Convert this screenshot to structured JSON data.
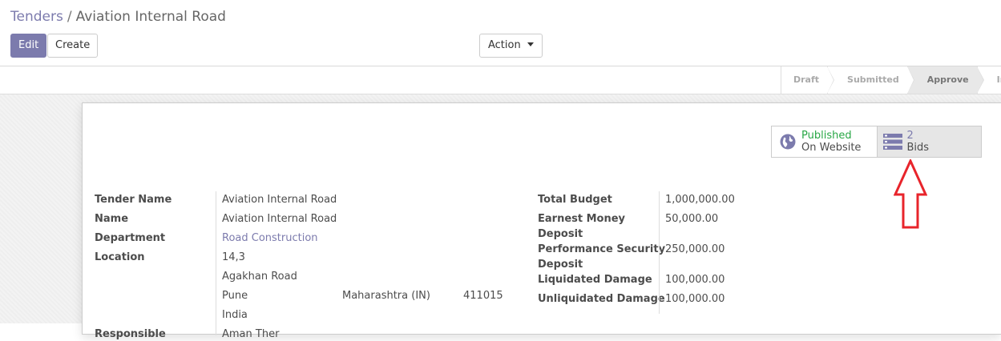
{
  "breadcrumb": {
    "parent": "Tenders",
    "separator": "/",
    "current": "Aviation Internal Road"
  },
  "buttons": {
    "edit": "Edit",
    "create": "Create",
    "action": "Action"
  },
  "statusbar": {
    "stages": [
      {
        "label": "Draft",
        "active": false
      },
      {
        "label": "Submitted",
        "active": false
      },
      {
        "label": "Approve",
        "active": true
      },
      {
        "label": "In Progress",
        "active": false
      }
    ]
  },
  "smart_buttons": {
    "website": {
      "status": "Published",
      "label": "On Website",
      "icon": "globe-icon"
    },
    "bids": {
      "count": "2",
      "label": "Bids",
      "icon": "bids-stack-icon"
    }
  },
  "colors": {
    "brand": "#7c7bad",
    "published": "#28a745",
    "annotation_arrow": "#e8242b"
  },
  "form": {
    "left": {
      "tender_name_label": "Tender Name",
      "tender_name": "Aviation Internal Road",
      "name_label": "Name",
      "name": "Aviation Internal Road",
      "department_label": "Department",
      "department": "Road Construction",
      "location_label": "Location",
      "street": "14,3",
      "street2": "Agakhan Road",
      "city": "Pune",
      "state": "Maharashtra (IN)",
      "zip": "411015",
      "country": "India",
      "responsible_label": "Responsible",
      "responsible": "Aman Ther"
    },
    "right": {
      "total_budget_label": "Total Budget",
      "total_budget": "1,000,000.00",
      "earnest_label_1": "Earnest Money",
      "earnest_label_2": "Deposit",
      "earnest": "50,000.00",
      "performance_label_1": "Performance Security",
      "performance_label_2": "Deposit",
      "performance": "250,000.00",
      "liquidated_label": "Liquidated Damage",
      "liquidated": "100,000.00",
      "unliquidated_label": "Unliquidated Damage",
      "unliquidated": "100,000.00"
    }
  }
}
